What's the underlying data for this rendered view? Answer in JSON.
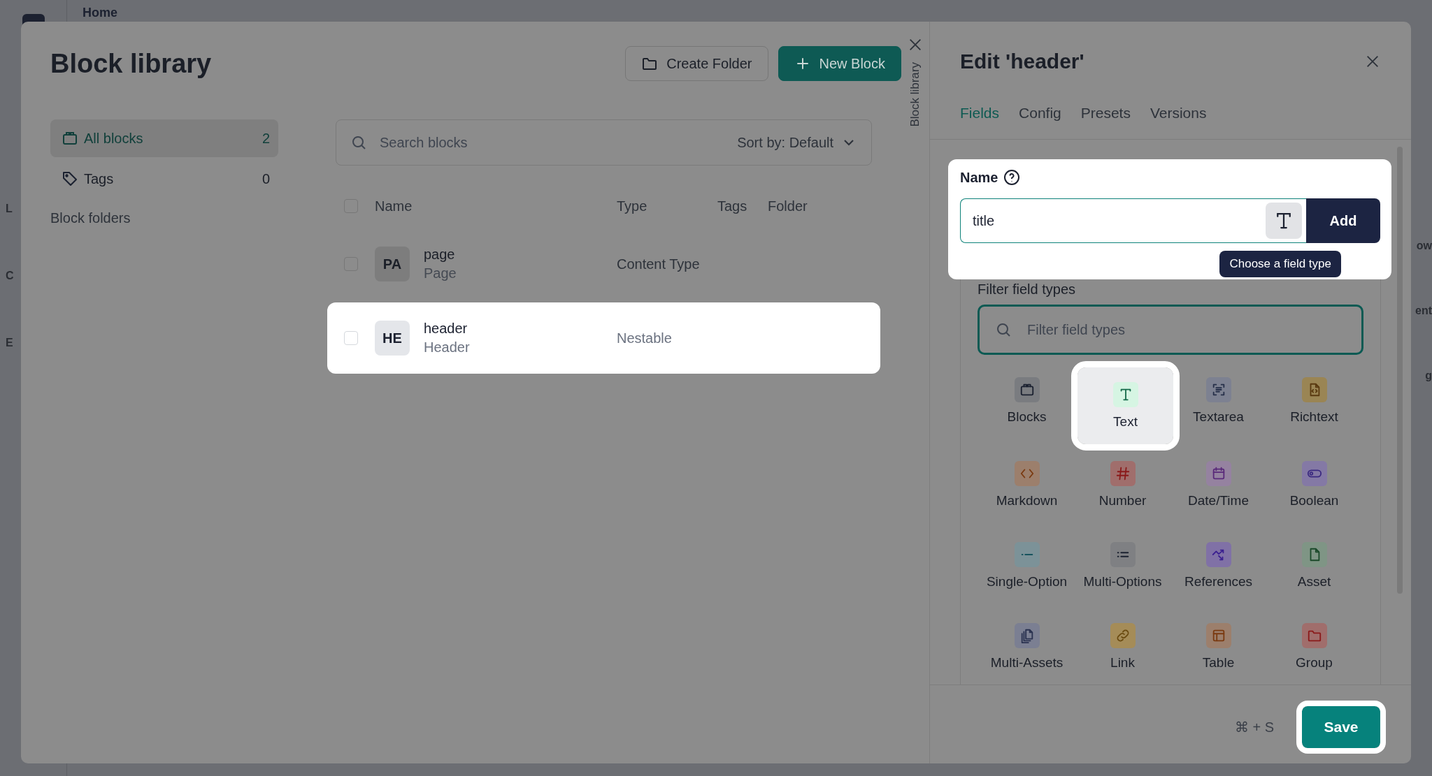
{
  "background": {
    "breadcrumb": "Home",
    "left_fragments": [
      "L",
      "C",
      "E"
    ],
    "right_fragments": [
      "ow",
      "ent",
      "g"
    ]
  },
  "library": {
    "title": "Block library",
    "side_label": "Block library",
    "buttons": [
      {
        "label": "Create Folder",
        "kind": "folder"
      },
      {
        "label": "New Block",
        "kind": "plus"
      }
    ],
    "sidebar": [
      {
        "label": "All blocks",
        "count": "2",
        "selected": true,
        "kind": "blocks"
      },
      {
        "label": "Tags",
        "count": "0",
        "selected": false,
        "kind": "tag"
      }
    ],
    "folders_label": "Block folders",
    "search": {
      "placeholder": "Search blocks",
      "sort": "Sort by: Default"
    },
    "table": {
      "select_all_checked": false,
      "columns": [
        "Name",
        "Type",
        "Tags",
        "Folder"
      ],
      "rows": [
        {
          "initials": "PA",
          "name": "page",
          "subtitle": "Page",
          "type": "Content Type",
          "checked": false,
          "highlighted": false
        },
        {
          "initials": "HE",
          "name": "header",
          "subtitle": "Header",
          "type": "Nestable",
          "checked": false,
          "highlighted": true
        }
      ]
    }
  },
  "editor": {
    "title": "Edit 'header'",
    "tabs": [
      {
        "label": "Fields",
        "selected": true
      },
      {
        "label": "Config",
        "selected": false
      },
      {
        "label": "Presets",
        "selected": false
      },
      {
        "label": "Versions",
        "selected": false
      }
    ],
    "name_label": "Name",
    "name_value": "title",
    "add_button": "Add",
    "tooltip": "Choose a field type",
    "filter_label": "Filter field types",
    "filter_placeholder": "Filter field types",
    "field_types": [
      {
        "label": "Blocks",
        "kind": "blocks",
        "color": "#7a7c80",
        "selected": false
      },
      {
        "label": "Text",
        "kind": "text",
        "color": "#d6f5e3",
        "selected": true
      },
      {
        "label": "Textarea",
        "kind": "textarea",
        "color": "#7d8191",
        "selected": false
      },
      {
        "label": "Richtext",
        "kind": "richtext",
        "color": "#9a8554",
        "selected": false
      },
      {
        "label": "Markdown",
        "kind": "markdown",
        "color": "#9c7f6c",
        "selected": false
      },
      {
        "label": "Number",
        "kind": "number",
        "color": "#a06e6c",
        "selected": false
      },
      {
        "label": "Date/Time",
        "kind": "datetime",
        "color": "#9582a0",
        "selected": false
      },
      {
        "label": "Boolean",
        "kind": "boolean",
        "color": "#8479a5",
        "selected": false
      },
      {
        "label": "Single-Option",
        "kind": "single",
        "color": "#7c9298",
        "selected": false
      },
      {
        "label": "Multi-Options",
        "kind": "multi",
        "color": "#7f8083",
        "selected": false
      },
      {
        "label": "References",
        "kind": "references",
        "color": "#8071a6",
        "selected": false
      },
      {
        "label": "Asset",
        "kind": "asset",
        "color": "#7f9585",
        "selected": false
      },
      {
        "label": "Multi-Assets",
        "kind": "assets",
        "color": "#7b7f92",
        "selected": false
      },
      {
        "label": "Link",
        "kind": "link",
        "color": "#a58c58",
        "selected": false
      },
      {
        "label": "Table",
        "kind": "table",
        "color": "#9c7f6c",
        "selected": false
      },
      {
        "label": "Group",
        "kind": "group",
        "color": "#a06e6c",
        "selected": false
      }
    ],
    "shortcut": "⌘ + S",
    "save_button": "Save"
  }
}
